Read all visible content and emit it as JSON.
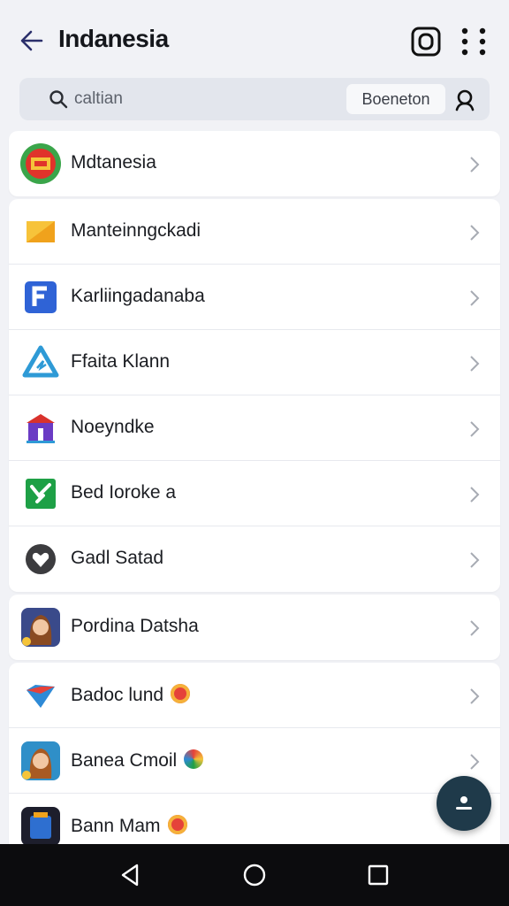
{
  "header": {
    "title": "Indanesia"
  },
  "search": {
    "text": "caltian",
    "chip": "Boeneton"
  },
  "items": [
    {
      "label": "Mdtanesia"
    },
    {
      "label": "Manteinngckadi"
    },
    {
      "label": "Karliingadanaba"
    },
    {
      "label": "Ffaita Klann"
    },
    {
      "label": "Noeyndke"
    },
    {
      "label": "Bed Ioroke a"
    },
    {
      "label": "Gadl Satad"
    },
    {
      "label": "Pordina Datsha"
    },
    {
      "label": "Badoc lund"
    },
    {
      "label": "Banea Cmoil"
    },
    {
      "label": "Bann Mam"
    }
  ],
  "colors": {
    "accent": "#1f3a4a",
    "background": "#f1f2f6",
    "navbar": "#0c0c0e"
  }
}
